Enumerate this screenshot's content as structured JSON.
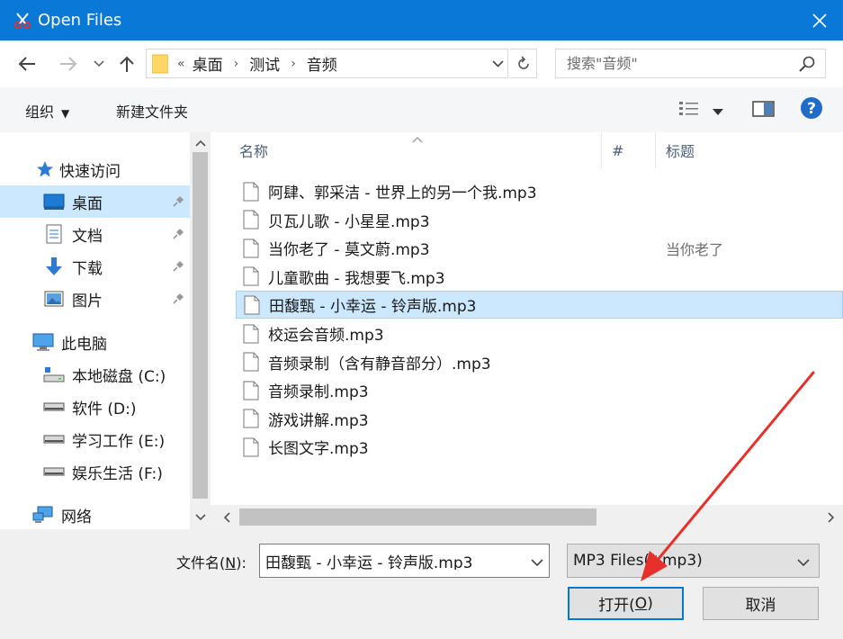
{
  "window": {
    "title": "Open Files",
    "close_glyph": "✕"
  },
  "address_bar": {
    "overflow_marker": "«",
    "breadcrumbs": [
      "桌面",
      "测试",
      "音频"
    ],
    "search_placeholder": "搜索\"音频\""
  },
  "command_bar": {
    "organize_label": "组织",
    "new_folder_label": "新建文件夹"
  },
  "nav_pane": {
    "items": [
      {
        "label": "快速访问",
        "icon": "star-icon",
        "pinned": false
      },
      {
        "label": "桌面",
        "icon": "desktop-icon",
        "pinned": true,
        "selected": true
      },
      {
        "label": "文档",
        "icon": "document-icon",
        "pinned": true
      },
      {
        "label": "下载",
        "icon": "download-icon",
        "pinned": true
      },
      {
        "label": "图片",
        "icon": "picture-icon",
        "pinned": true
      },
      {
        "label": "此电脑",
        "icon": "computer-icon",
        "pinned": false
      },
      {
        "label": "本地磁盘 (C:)",
        "icon": "system-drive-icon",
        "pinned": false
      },
      {
        "label": "软件 (D:)",
        "icon": "drive-icon",
        "pinned": false
      },
      {
        "label": "学习工作 (E:)",
        "icon": "drive-icon",
        "pinned": false
      },
      {
        "label": "娱乐生活 (F:)",
        "icon": "drive-icon",
        "pinned": false
      },
      {
        "label": "网络",
        "icon": "network-icon",
        "pinned": false
      }
    ]
  },
  "file_list": {
    "columns": {
      "name": "名称",
      "number": "#",
      "title": "标题"
    },
    "files": [
      {
        "name": "阿肆、郭采洁 - 世界上的另一个我.mp3",
        "title": ""
      },
      {
        "name": "贝瓦儿歌 - 小星星.mp3",
        "title": ""
      },
      {
        "name": "当你老了 - 莫文蔚.mp3",
        "title": "当你老了"
      },
      {
        "name": "儿童歌曲 - 我想要飞.mp3",
        "title": ""
      },
      {
        "name": "田馥甄 - 小幸运 - 铃声版.mp3",
        "title": "",
        "selected": true
      },
      {
        "name": "校运会音频.mp3",
        "title": ""
      },
      {
        "name": "音频录制（含有静音部分）.mp3",
        "title": ""
      },
      {
        "name": "音频录制.mp3",
        "title": ""
      },
      {
        "name": "游戏讲解.mp3",
        "title": ""
      },
      {
        "name": "长图文字.mp3",
        "title": ""
      }
    ]
  },
  "bottom": {
    "filename_label_prefix": "文件名(",
    "filename_label_key": "N",
    "filename_label_suffix": "):",
    "filename_value": "田馥甄 - 小幸运 - 铃声版.mp3",
    "filetype_value": "MP3 Files(*.mp3)",
    "open_label_prefix": "打开(",
    "open_label_key": "O",
    "open_label_suffix": ")",
    "cancel_label": "取消"
  },
  "colors": {
    "titlebar": "#0a78d7",
    "selection": "#cce8ff",
    "annotation_arrow": "#e8302a"
  }
}
